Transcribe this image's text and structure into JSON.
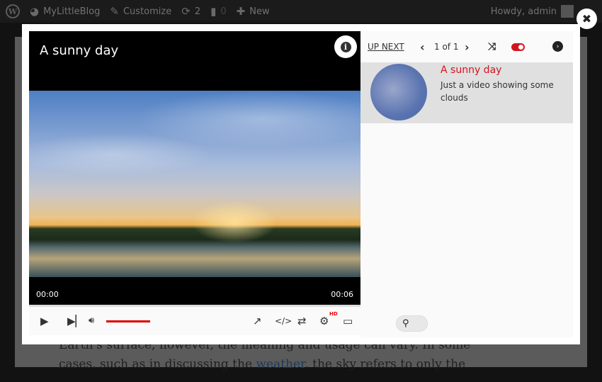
{
  "adminbar": {
    "site": "MyLittleBlog",
    "customize": "Customize",
    "updates": "2",
    "comments": "0",
    "new": "New",
    "howdy": "Howdy, admin"
  },
  "background": {
    "line1": "Earth's surface, however, the meaning and usage can vary. In some",
    "line2_pre": "cases, such as in discussing the ",
    "line2_link": "weather",
    "line2_post": ", the sky refers to only the"
  },
  "player": {
    "title": "A sunny day",
    "time_current": "00:00",
    "time_total": "00:06",
    "progress_fraction": 0,
    "volume_fraction": 1,
    "hd_badge": "HD"
  },
  "playlist": {
    "up_next": "UP NEXT",
    "pager": "1 of 1",
    "autoplay_on": true,
    "items": [
      {
        "title": "A sunny day",
        "description": "Just a video showing some clouds"
      }
    ]
  },
  "colors": {
    "accent": "#d4141c"
  }
}
